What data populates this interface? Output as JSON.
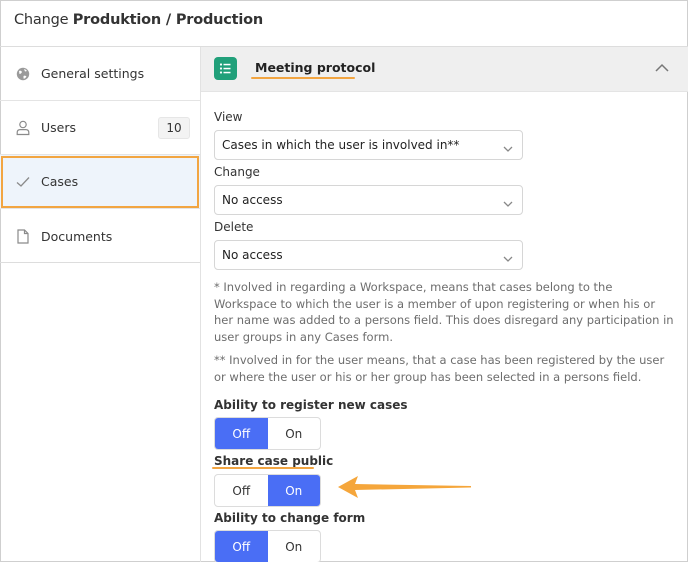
{
  "header": {
    "prefix": "Change",
    "title": "Produktion / Production"
  },
  "sidebar": {
    "items": [
      {
        "label": "General settings",
        "icon": "globe-icon"
      },
      {
        "label": "Users",
        "icon": "user-icon",
        "badge": "10"
      },
      {
        "label": "Cases",
        "icon": "check-icon",
        "active": true
      },
      {
        "label": "Documents",
        "icon": "document-icon"
      }
    ]
  },
  "section": {
    "title": "Meeting protocol",
    "icon": "list-icon",
    "expanded": true
  },
  "fields": {
    "view": {
      "label": "View",
      "value": "Cases in which the user is involved in**"
    },
    "change": {
      "label": "Change",
      "value": "No access"
    },
    "delete": {
      "label": "Delete",
      "value": "No access"
    }
  },
  "notes": {
    "note1": "* Involved in regarding a Workspace, means that cases belong to the Workspace to which the user is a member of upon registering or when his or her name was added to a persons field. This does disregard any participation in user groups in any Cases form.",
    "note2": "** Involved in for the user means, that a case has been registered by the user or where the user or his or her group has been selected in a persons field."
  },
  "toggles": [
    {
      "label": "Ability to register new cases",
      "off": "Off",
      "on": "On",
      "selected": "Off"
    },
    {
      "label": "Share case public",
      "off": "Off",
      "on": "On",
      "selected": "On"
    },
    {
      "label": "Ability to change form",
      "off": "Off",
      "on": "On",
      "selected": "Off"
    }
  ],
  "colors": {
    "accent": "#4a6ef5",
    "section_icon": "#21a07a",
    "annotation": "#f2a541",
    "active_bg": "#eef4fb"
  }
}
